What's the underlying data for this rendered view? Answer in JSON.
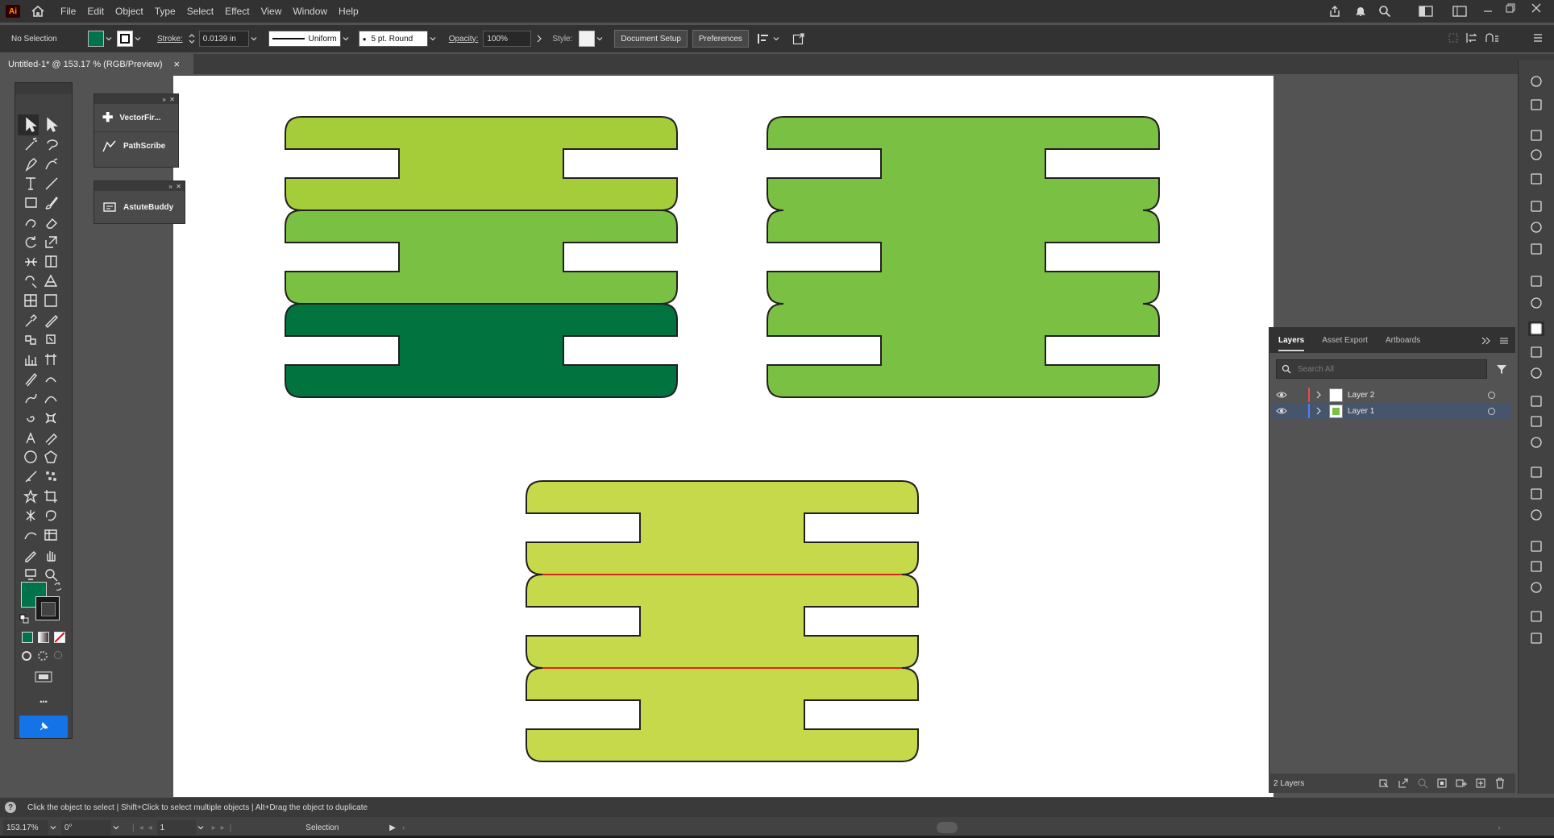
{
  "menubar": {
    "logo": "Ai",
    "items": [
      "File",
      "Edit",
      "Object",
      "Type",
      "Select",
      "Effect",
      "View",
      "Window",
      "Help"
    ]
  },
  "control": {
    "selection_label": "No Selection",
    "fill_color": "#00734a",
    "stroke_label": "Stroke:",
    "stroke_weight": "0.0139 in",
    "profile_label": "Uniform",
    "brush_label": "5 pt. Round",
    "opacity_label": "Opacity:",
    "opacity_value": "100%",
    "style_label": "Style:",
    "document_setup": "Document Setup",
    "preferences": "Preferences"
  },
  "document": {
    "tab_title": "Untitled-1* @ 153.17 % (RGB/Preview)",
    "close_glyph": "×"
  },
  "plugins": {
    "panel1": [
      "VectorFir...",
      "PathScribe"
    ],
    "panel2": [
      "AstuteBuddy"
    ]
  },
  "toolbox": {
    "fill_color": "#00734a",
    "more_glyph": "•••"
  },
  "artwork": {
    "shape1_colors": [
      "#a5cd39",
      "#7ac143",
      "#00733e"
    ],
    "shape2_color": "#7ac143",
    "shape3_color": "#c6d94a",
    "stroke_color": "#231f20",
    "highlight_line_color": "#e0251b"
  },
  "layers_panel": {
    "tabs": [
      "Layers",
      "Asset Export",
      "Artboards"
    ],
    "search_placeholder": "Search All",
    "layers": [
      {
        "name": "Layer 2",
        "color": "#e24d4d",
        "selected": false
      },
      {
        "name": "Layer 1",
        "color": "#4f80ff",
        "selected": true
      }
    ],
    "count": "2 Layers"
  },
  "status": {
    "hint": "Click the object to select  |  Shift+Click to select multiple objects  |  Alt+Drag the object to duplicate",
    "zoom": "153.17%",
    "rotation": "0°",
    "artboard_number": "1",
    "tool_name": "Selection"
  }
}
